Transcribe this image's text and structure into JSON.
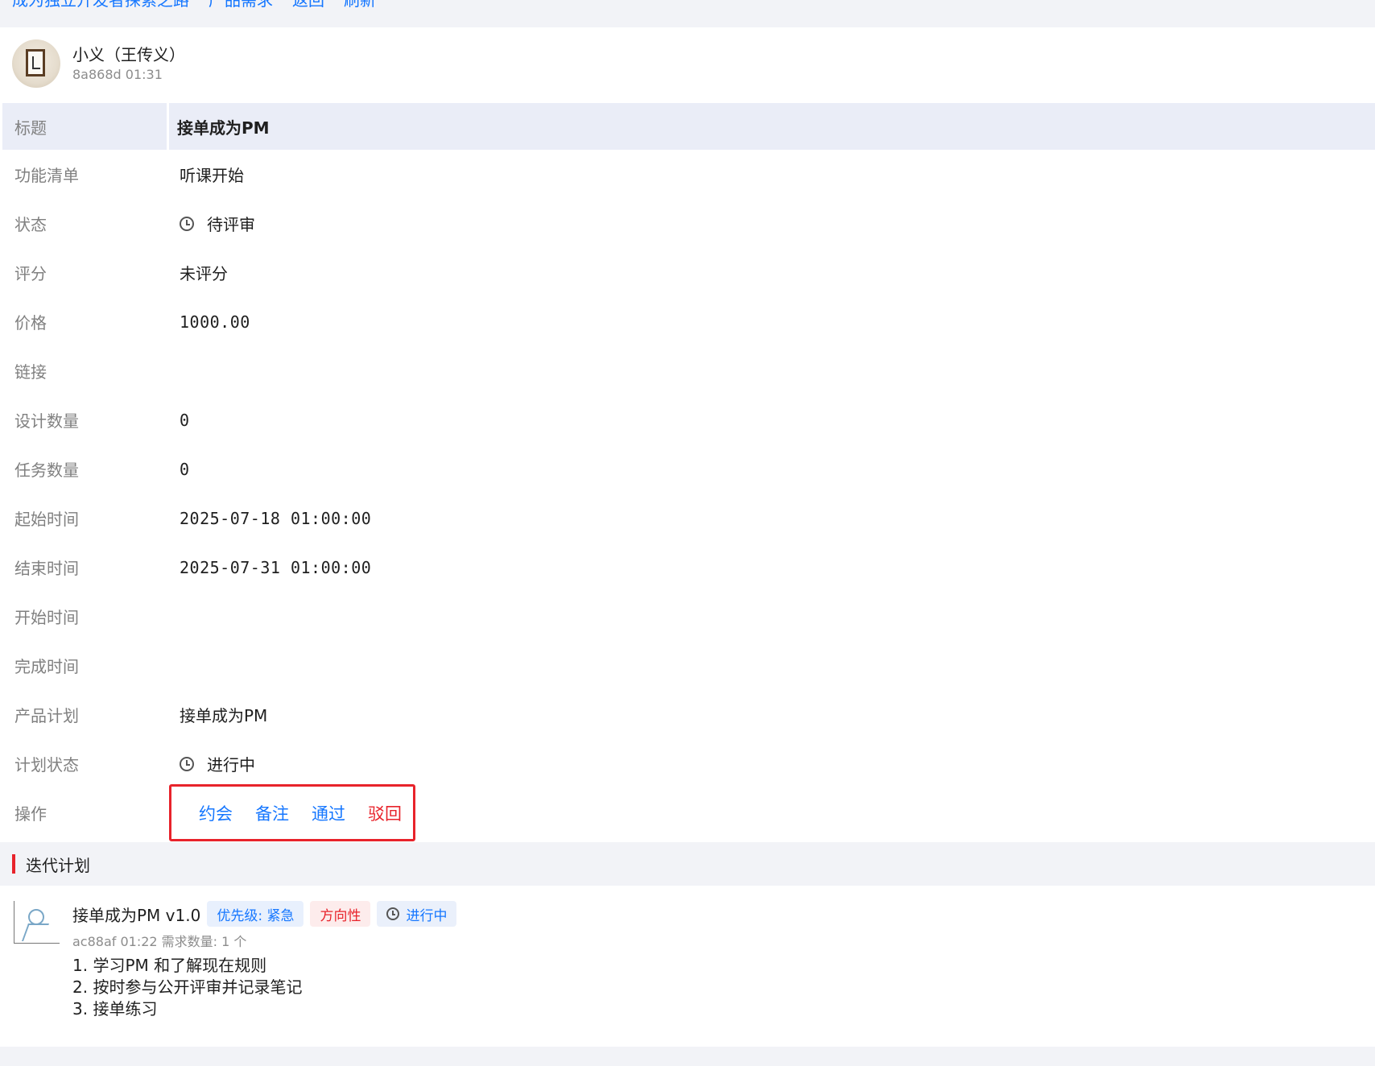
{
  "nav": {
    "links": [
      "成为独立开发者探索之路",
      "产品需求",
      "返回",
      "刷新"
    ]
  },
  "user": {
    "name": "小义（王传义）",
    "meta": "8a868d 01:31",
    "avatar_icon": "framed-calligraphy-avatar"
  },
  "details": {
    "title_label": "标题",
    "title_value": "接单成为PM",
    "features_label": "功能清单",
    "features_value": "听课开始",
    "status_label": "状态",
    "status_value": "待评审",
    "rating_label": "评分",
    "rating_value": "未评分",
    "price_label": "价格",
    "price_value": "1000.00",
    "link_label": "链接",
    "link_value": "",
    "design_count_label": "设计数量",
    "design_count_value": "0",
    "task_count_label": "任务数量",
    "task_count_value": "0",
    "start_label": "起始时间",
    "start_value": "2025-07-18 01:00:00",
    "end_label": "结束时间",
    "end_value": "2025-07-31 01:00:00",
    "begin_label": "开始时间",
    "begin_value": "",
    "finish_label": "完成时间",
    "finish_value": "",
    "plan_label": "产品计划",
    "plan_value": "接单成为PM",
    "plan_status_label": "计划状态",
    "plan_status_value": "进行中",
    "ops_label": "操作"
  },
  "actions": {
    "appointment": "约会",
    "note": "备注",
    "approve": "通过",
    "reject": "驳回"
  },
  "section": {
    "title": "迭代计划"
  },
  "iteration": {
    "name": "接单成为PM v1.0",
    "priority_tag": "优先级: 紧急",
    "direction_tag": "方向性",
    "status_tag": "进行中",
    "meta": "ac88af 01:22 需求数量: 1 个",
    "items": [
      "1. 学习PM 和了解现在规则",
      "2. 按时参与公开评审并记录笔记",
      "3. 接单练习"
    ]
  },
  "colors": {
    "accent_blue": "#1677ff",
    "danger_red": "#e8232b",
    "header_row_bg": "#eaedf7",
    "page_bg": "#f2f3f7"
  }
}
